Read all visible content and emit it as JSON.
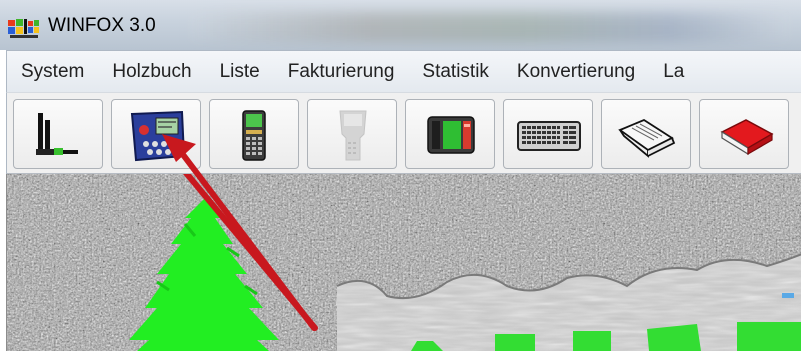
{
  "window": {
    "title": "WINFOX 3.0",
    "app_icon": "windows-flag-icon"
  },
  "menu": {
    "items": [
      {
        "label": "System"
      },
      {
        "label": "Holzbuch"
      },
      {
        "label": "Liste"
      },
      {
        "label": "Fakturierung"
      },
      {
        "label": "Statistik"
      },
      {
        "label": "Konvertierung"
      },
      {
        "label": "La"
      }
    ]
  },
  "toolbar": {
    "buttons": [
      {
        "icon": "plug-cable-icon",
        "enabled": true
      },
      {
        "icon": "handheld-terminal-icon",
        "enabled": true
      },
      {
        "icon": "mobile-data-device-icon",
        "enabled": true
      },
      {
        "icon": "mobile-device-disabled-icon",
        "enabled": false
      },
      {
        "icon": "device-screen-icon",
        "enabled": true
      },
      {
        "icon": "keyboard-icon",
        "enabled": true
      },
      {
        "icon": "open-book-icon",
        "enabled": true
      },
      {
        "icon": "red-book-icon",
        "enabled": true
      }
    ]
  },
  "colors": {
    "arrow": "#c8181e",
    "tree": "#22ee22",
    "logo_text": "#33dd33"
  },
  "background": {
    "decor": "stone-texture-with-tree-and-logo"
  }
}
